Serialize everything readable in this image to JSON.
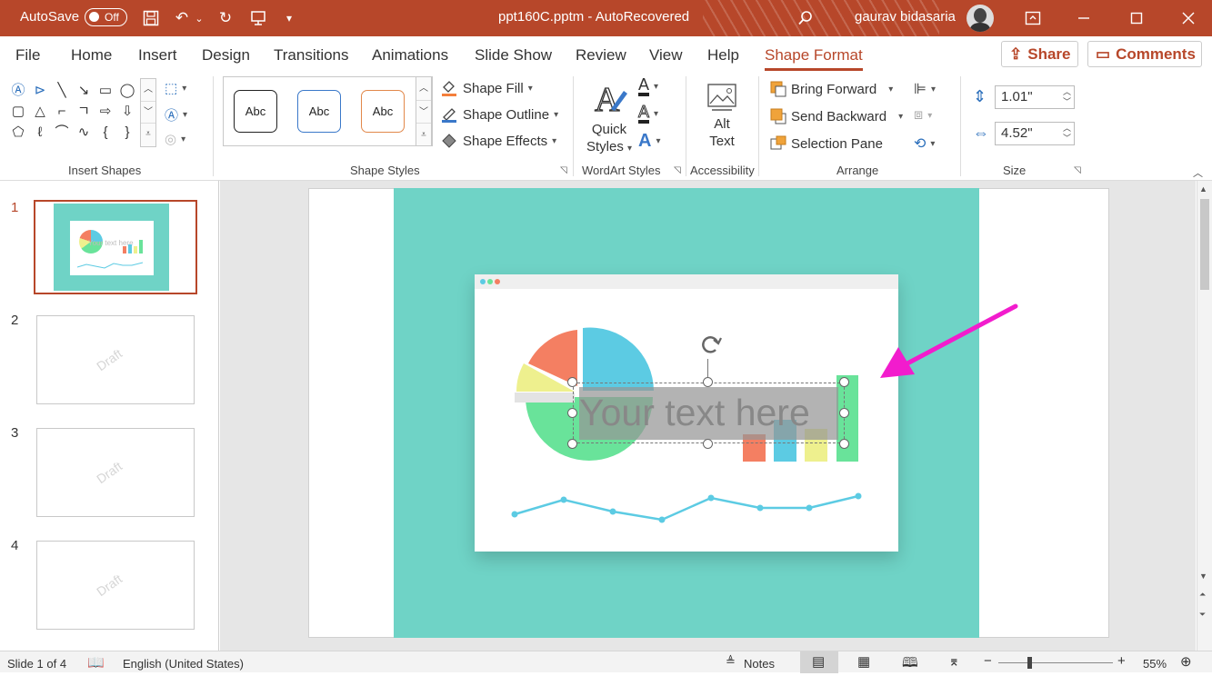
{
  "titlebar": {
    "autosave_label": "AutoSave",
    "autosave_state": "Off",
    "document_title": "ppt160C.pptm  -  AutoRecovered",
    "user_name": "gaurav bidasaria"
  },
  "tabs": [
    {
      "label": "File"
    },
    {
      "label": "Home"
    },
    {
      "label": "Insert"
    },
    {
      "label": "Design"
    },
    {
      "label": "Transitions"
    },
    {
      "label": "Animations"
    },
    {
      "label": "Slide Show"
    },
    {
      "label": "Review"
    },
    {
      "label": "View"
    },
    {
      "label": "Help"
    },
    {
      "label": "Shape Format"
    }
  ],
  "actions": {
    "share": "Share",
    "comments": "Comments"
  },
  "ribbon": {
    "insert_shapes_label": "Insert Shapes",
    "shape_styles": {
      "label": "Shape Styles",
      "gallery": [
        "Abc",
        "Abc",
        "Abc"
      ],
      "fill": "Shape Fill",
      "outline": "Shape Outline",
      "effects": "Shape Effects"
    },
    "wordart": {
      "label": "WordArt Styles",
      "quick_styles_line1": "Quick",
      "quick_styles_line2": "Styles",
      "letter": "A"
    },
    "accessibility": {
      "label": "Accessibility",
      "alt_text_line1": "Alt",
      "alt_text_line2": "Text"
    },
    "arrange": {
      "label": "Arrange",
      "bring_forward": "Bring Forward",
      "send_backward": "Send Backward",
      "selection_pane": "Selection Pane"
    },
    "size": {
      "label": "Size",
      "height": "1.01\"",
      "width": "4.52\""
    }
  },
  "slides": [
    {
      "number": "1",
      "watermark": ""
    },
    {
      "number": "2",
      "watermark": "Draft"
    },
    {
      "number": "3",
      "watermark": "Draft"
    },
    {
      "number": "4",
      "watermark": "Draft"
    }
  ],
  "slide": {
    "textbox_text": "Your text here",
    "thumb_text": "Your text here"
  },
  "status": {
    "slide_info": "Slide 1 of 4",
    "language": "English (United States)",
    "notes": "Notes",
    "zoom": "55%"
  },
  "colors": {
    "accent": "#b7472a",
    "teal": "#6fd3c6",
    "pie_orange": "#f47f62",
    "pie_blue": "#5ccbe3",
    "pie_yellow": "#eef08e",
    "pie_green": "#69e39a",
    "arrow": "#f21ccd"
  }
}
